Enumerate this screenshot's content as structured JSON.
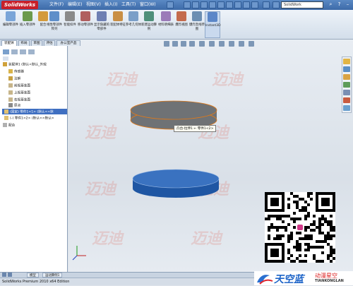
{
  "app": {
    "logo": "SolidWorks",
    "menus": [
      "文件(F)",
      "编辑(E)",
      "视图(V)",
      "插入(I)",
      "工具(T)",
      "窗口(W)"
    ],
    "search_placeholder": "SolidWork"
  },
  "ribbon": {
    "tools": [
      {
        "label": "编辑零部件",
        "color": "#7aa5d8"
      },
      {
        "label": "插入零部件",
        "color": "#6b9a4c"
      },
      {
        "label": "配合",
        "color": "#d39a3b"
      },
      {
        "label": "线性零部件阵列",
        "color": "#5f8fc9"
      },
      {
        "label": "智能扣件",
        "color": "#8a8a8a"
      },
      {
        "label": "移动零部件",
        "color": "#b05f5f"
      },
      {
        "label": "显示隐藏的零部件",
        "color": "#6e7fb3"
      },
      {
        "label": "装配体特征",
        "color": "#c98f45"
      },
      {
        "label": "参考几何体",
        "color": "#7b9fc8"
      },
      {
        "label": "新建运动算例",
        "color": "#4e8f7a"
      },
      {
        "label": "材料明细表",
        "color": "#9b7bb8"
      },
      {
        "label": "爆炸视图",
        "color": "#c46b4d"
      },
      {
        "label": "爆炸直线草图",
        "color": "#6c8eb2"
      },
      {
        "label": "Instant3D",
        "color": "#5b86c8"
      }
    ]
  },
  "panel_tabs": [
    "装配体",
    "布局",
    "草图",
    "评估",
    "办公室产品"
  ],
  "tree": [
    {
      "label": "装配体1 (默认<默认_外观",
      "icon": "#d0a23a"
    },
    {
      "label": "传感器",
      "icon": "#d9b44a"
    },
    {
      "label": "注解",
      "icon": "#c8a040"
    },
    {
      "label": "前视基准面",
      "icon": "#c7b58a"
    },
    {
      "label": "上视基准面",
      "icon": "#c7b58a"
    },
    {
      "label": "右视基准面",
      "icon": "#c7b58a"
    },
    {
      "label": "原点",
      "icon": "#8a8a8a"
    },
    {
      "label": "(固定) 零件1<1> (默认<<默",
      "icon": "#e0c070"
    },
    {
      "label": "(-) 零件1<2> (默认<<默认>",
      "icon": "#e0c070"
    },
    {
      "label": "配合",
      "icon": "#b0b0b0"
    }
  ],
  "viewport": {
    "tooltip": "凸台-拉伸1 ← 零件1<2>",
    "top_cylinder_color": "#6f7275",
    "bottom_cylinder_color": "#1f56a3",
    "selection_edge_color": "#e07a1a",
    "watermark": "迈迪"
  },
  "bottom_tabs": [
    "模型",
    "运动算例1"
  ],
  "status": "SolidWorks Premium 2010 x64 Edition",
  "brand": {
    "name": "天空蓝",
    "subtitle": "动漫星空",
    "en": "TIANKONGLAN"
  }
}
